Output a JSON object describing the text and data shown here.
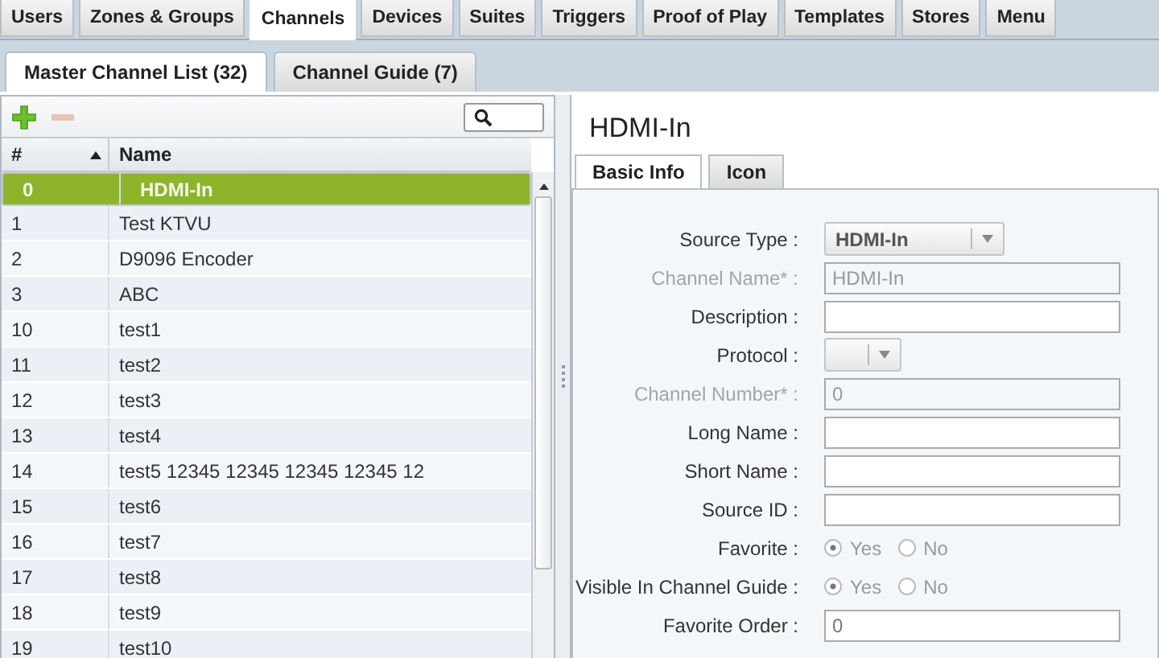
{
  "main_tabs": [
    {
      "label": "Users",
      "selected": false
    },
    {
      "label": "Zones & Groups",
      "selected": false
    },
    {
      "label": "Channels",
      "selected": true
    },
    {
      "label": "Devices",
      "selected": false
    },
    {
      "label": "Suites",
      "selected": false
    },
    {
      "label": "Triggers",
      "selected": false
    },
    {
      "label": "Proof of Play",
      "selected": false
    },
    {
      "label": "Templates",
      "selected": false
    },
    {
      "label": "Stores",
      "selected": false
    },
    {
      "label": "Menu",
      "selected": false
    }
  ],
  "sub_tabs": [
    {
      "label": "Master Channel List (32)",
      "selected": true
    },
    {
      "label": "Channel Guide (7)",
      "selected": false
    }
  ],
  "channel_list": {
    "add_disabled": false,
    "remove_disabled": true,
    "columns": [
      {
        "label": "#"
      },
      {
        "label": "Name"
      }
    ],
    "rows": [
      {
        "number": "0",
        "name": "HDMI-In",
        "selected": true
      },
      {
        "number": "1",
        "name": "Test KTVU",
        "selected": false
      },
      {
        "number": "2",
        "name": "D9096 Encoder",
        "selected": false
      },
      {
        "number": "3",
        "name": "ABC",
        "selected": false
      },
      {
        "number": "10",
        "name": "test1",
        "selected": false
      },
      {
        "number": "11",
        "name": "test2",
        "selected": false
      },
      {
        "number": "12",
        "name": "test3",
        "selected": false
      },
      {
        "number": "13",
        "name": "test4",
        "selected": false
      },
      {
        "number": "14",
        "name": "test5 12345 12345 12345 12345 12",
        "selected": false
      },
      {
        "number": "15",
        "name": "test6",
        "selected": false
      },
      {
        "number": "16",
        "name": "test7",
        "selected": false
      },
      {
        "number": "17",
        "name": "test8",
        "selected": false
      },
      {
        "number": "18",
        "name": "test9",
        "selected": false
      },
      {
        "number": "19",
        "name": "test10",
        "selected": false
      }
    ]
  },
  "detail": {
    "title": "HDMI-In",
    "tabs": [
      {
        "label": "Basic Info",
        "selected": true
      },
      {
        "label": "Icon",
        "selected": false
      }
    ],
    "fields": [
      {
        "kind": "select",
        "label": "Source Type :",
        "value": "HDMI-In",
        "disabled": false
      },
      {
        "kind": "text",
        "label": "Channel Name* :",
        "value": "HDMI-In",
        "disabled": true
      },
      {
        "kind": "text",
        "label": "Description :",
        "disabled": false
      },
      {
        "kind": "select",
        "label": "Protocol :",
        "disabled": false
      },
      {
        "kind": "text",
        "label": "Channel Number* :",
        "value": "0",
        "disabled": true
      },
      {
        "kind": "text",
        "label": "Long Name :",
        "disabled": false
      },
      {
        "kind": "text",
        "label": "Short Name :",
        "disabled": false
      },
      {
        "kind": "text",
        "label": "Source ID :",
        "disabled": false
      },
      {
        "kind": "radio",
        "label": "Favorite :",
        "options": [
          {
            "label": "Yes",
            "selected": true
          },
          {
            "label": "No",
            "selected": false
          }
        ]
      },
      {
        "kind": "radio",
        "label": "Visible In Channel Guide :",
        "options": [
          {
            "label": "Yes",
            "selected": true
          },
          {
            "label": "No",
            "selected": false
          }
        ]
      },
      {
        "kind": "text",
        "label": "Favorite Order :",
        "value": "0",
        "disabled": false
      }
    ]
  }
}
